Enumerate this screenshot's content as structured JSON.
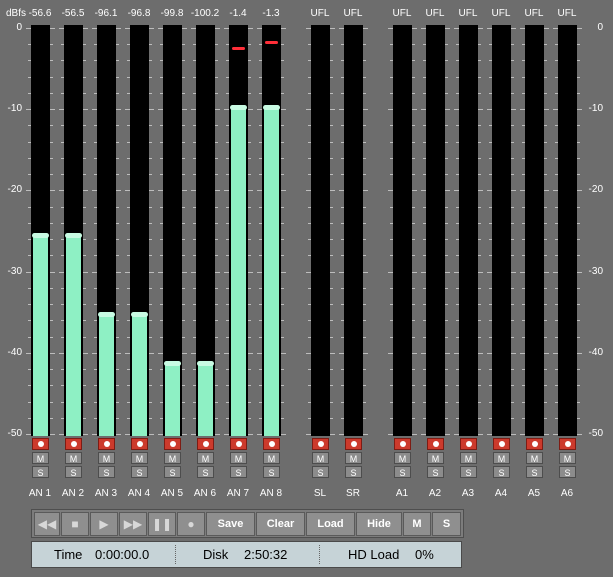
{
  "scale": {
    "unit": "dBfs",
    "labels": [
      "0",
      "-10",
      "-20",
      "-30",
      "-40",
      "-50"
    ]
  },
  "channels": [
    {
      "name": "AN 1",
      "peak": "-56.6",
      "level_db": -25.3,
      "hold_db": null
    },
    {
      "name": "AN 2",
      "peak": "-56.5",
      "level_db": -25.3,
      "hold_db": null
    },
    {
      "name": "AN 3",
      "peak": "-96.1",
      "level_db": -35.0,
      "hold_db": null
    },
    {
      "name": "AN 4",
      "peak": "-96.8",
      "level_db": -35.0,
      "hold_db": null
    },
    {
      "name": "AN 5",
      "peak": "-99.8",
      "level_db": -41.0,
      "hold_db": null
    },
    {
      "name": "AN 6",
      "peak": "-100.2",
      "level_db": -41.0,
      "hold_db": null
    },
    {
      "name": "AN 7",
      "peak": "-1.4",
      "level_db": -9.5,
      "hold_db": -1.4
    },
    {
      "name": "AN 8",
      "peak": "-1.3",
      "level_db": -9.5,
      "hold_db": -0.6
    },
    {
      "name": "SL",
      "peak": "UFL",
      "level_db": -50,
      "hold_db": null
    },
    {
      "name": "SR",
      "peak": "UFL",
      "level_db": -50,
      "hold_db": null
    },
    {
      "name": "A1",
      "peak": "UFL",
      "level_db": -50,
      "hold_db": null
    },
    {
      "name": "A2",
      "peak": "UFL",
      "level_db": -50,
      "hold_db": null
    },
    {
      "name": "A3",
      "peak": "UFL",
      "level_db": -50,
      "hold_db": null
    },
    {
      "name": "A4",
      "peak": "UFL",
      "level_db": -50,
      "hold_db": null
    },
    {
      "name": "A5",
      "peak": "UFL",
      "level_db": -50,
      "hold_db": null
    },
    {
      "name": "A6",
      "peak": "UFL",
      "level_db": -50,
      "hold_db": null
    }
  ],
  "channel_buttons": {
    "mute": "M",
    "solo": "S"
  },
  "transport": {
    "rewind_icon": "rewind-icon",
    "stop_icon": "stop-icon",
    "play_icon": "play-icon",
    "fast_forward_icon": "fast-forward-icon",
    "pause_icon": "pause-icon",
    "record_icon": "record-icon",
    "save_label": "Save",
    "clear_label": "Clear",
    "load_label": "Load",
    "hide_label": "Hide",
    "mute_label": "M",
    "solo_label": "S"
  },
  "status": {
    "time_label": "Time",
    "time_value": "0:00:00.0",
    "disk_label": "Disk",
    "disk_value": "2:50:32",
    "hdload_label": "HD Load",
    "hdload_value": "0%"
  },
  "colors": {
    "level_fill": "#8ef0c4",
    "peak_hold": "#ff2e38",
    "record_button": "#cc3a2c"
  }
}
